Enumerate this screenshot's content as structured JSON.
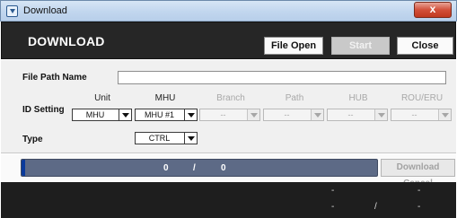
{
  "window": {
    "title": "Download",
    "close_glyph": "x"
  },
  "header": {
    "title": "DOWNLOAD",
    "file_open_label": "File Open",
    "start_label": "Start",
    "close_label": "Close"
  },
  "form": {
    "file_path_label": "File Path Name",
    "file_path_value": "",
    "id_setting_label": "ID Setting",
    "type_label": "Type",
    "columns": [
      "Unit",
      "MHU",
      "Branch",
      "Path",
      "HUB",
      "ROU/ERU"
    ],
    "unit_value": "MHU",
    "mhu_value": "MHU #1",
    "branch_value": "--",
    "path_value": "--",
    "hub_value": "--",
    "rou_value": "--",
    "type_value": "CTRL"
  },
  "progress": {
    "current": "0",
    "separator": "/",
    "total": "0",
    "fraction": 0.01,
    "download_cancel_label": "Download Cancel"
  },
  "status": {
    "top_left": "-",
    "top_right": "-",
    "bottom_left": "-",
    "separator": "/",
    "bottom_right": "-"
  },
  "colors": {
    "header_bg": "#262626",
    "progress_track": "#5d6a86",
    "progress_fill": "#0a3a9b"
  }
}
